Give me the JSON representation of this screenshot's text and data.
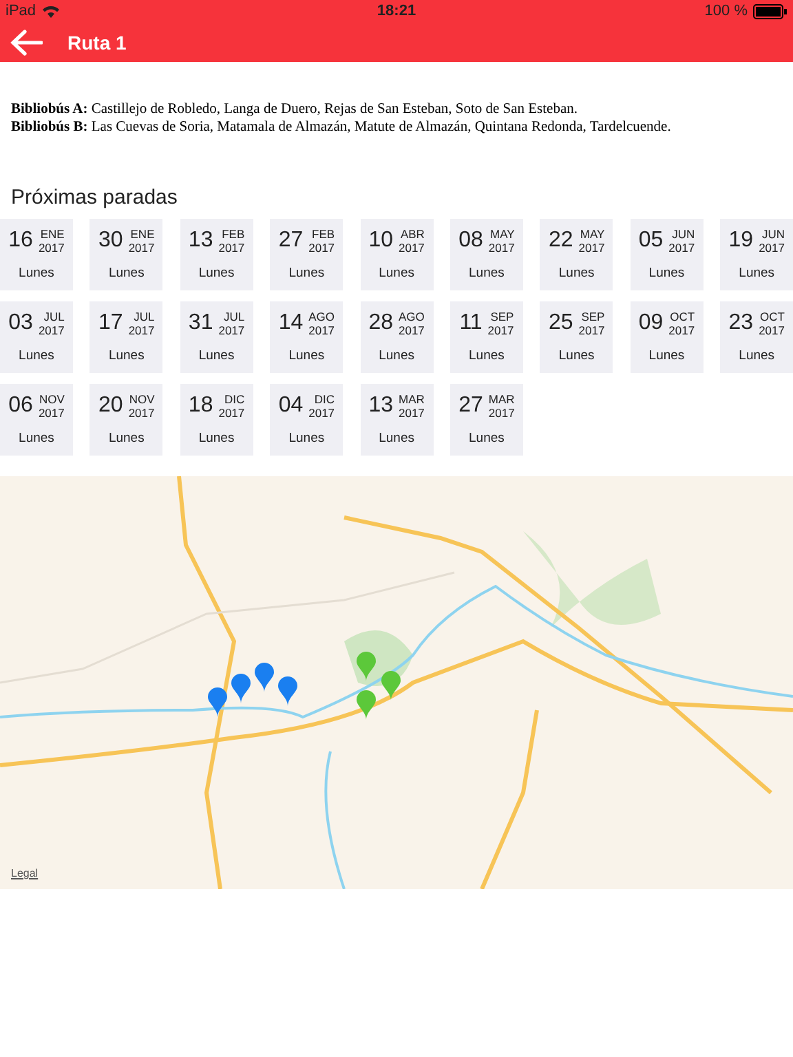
{
  "status_bar": {
    "carrier": "iPad",
    "time": "18:21",
    "battery": "100 %"
  },
  "nav": {
    "title": "Ruta 1"
  },
  "routes": [
    "**Bibliobús A:** Castillejo de Robledo, Langa de Duero, Rejas de San Esteban, Soto de San Esteban.",
    "**Bibliobús B:** Las Cuevas de Soria, Matamala de Almazán, Matute de Almazán, Quintana Redonda, Tardelcuende."
  ],
  "section_title": "Próximas paradas",
  "dates": [
    {
      "day": "16",
      "month": "ENE",
      "year": "2017",
      "weekday": "Lunes"
    },
    {
      "day": "30",
      "month": "ENE",
      "year": "2017",
      "weekday": "Lunes"
    },
    {
      "day": "13",
      "month": "FEB",
      "year": "2017",
      "weekday": "Lunes"
    },
    {
      "day": "27",
      "month": "FEB",
      "year": "2017",
      "weekday": "Lunes"
    },
    {
      "day": "10",
      "month": "ABR",
      "year": "2017",
      "weekday": "Lunes"
    },
    {
      "day": "08",
      "month": "MAY",
      "year": "2017",
      "weekday": "Lunes"
    },
    {
      "day": "22",
      "month": "MAY",
      "year": "2017",
      "weekday": "Lunes"
    },
    {
      "day": "05",
      "month": "JUN",
      "year": "2017",
      "weekday": "Lunes"
    },
    {
      "day": "19",
      "month": "JUN",
      "year": "2017",
      "weekday": "Lunes"
    },
    {
      "day": "03",
      "month": "JUL",
      "year": "2017",
      "weekday": "Lunes"
    },
    {
      "day": "17",
      "month": "JUL",
      "year": "2017",
      "weekday": "Lunes"
    },
    {
      "day": "31",
      "month": "JUL",
      "year": "2017",
      "weekday": "Lunes"
    },
    {
      "day": "14",
      "month": "AGO",
      "year": "2017",
      "weekday": "Lunes"
    },
    {
      "day": "28",
      "month": "AGO",
      "year": "2017",
      "weekday": "Lunes"
    },
    {
      "day": "11",
      "month": "SEP",
      "year": "2017",
      "weekday": "Lunes"
    },
    {
      "day": "25",
      "month": "SEP",
      "year": "2017",
      "weekday": "Lunes"
    },
    {
      "day": "09",
      "month": "OCT",
      "year": "2017",
      "weekday": "Lunes"
    },
    {
      "day": "23",
      "month": "OCT",
      "year": "2017",
      "weekday": "Lunes"
    },
    {
      "day": "06",
      "month": "NOV",
      "year": "2017",
      "weekday": "Lunes"
    },
    {
      "day": "20",
      "month": "NOV",
      "year": "2017",
      "weekday": "Lunes"
    },
    {
      "day": "18",
      "month": "DIC",
      "year": "2017",
      "weekday": "Lunes"
    },
    {
      "day": "04",
      "month": "DIC",
      "year": "2017",
      "weekday": "Lunes"
    },
    {
      "day": "13",
      "month": "MAR",
      "year": "2017",
      "weekday": "Lunes"
    },
    {
      "day": "27",
      "month": "MAR",
      "year": "2017",
      "weekday": "Lunes"
    }
  ],
  "map": {
    "kind": "picture",
    "legal": "Legal",
    "pins": [
      {
        "color": "#1a7ff0"
      },
      {
        "color": "#1a7ff0"
      },
      {
        "color": "#1a7ff0"
      },
      {
        "color": "#1a7ff0"
      },
      {
        "color": "#5cc83a"
      },
      {
        "color": "#5cc83a"
      },
      {
        "color": "#5cc83a"
      }
    ]
  }
}
